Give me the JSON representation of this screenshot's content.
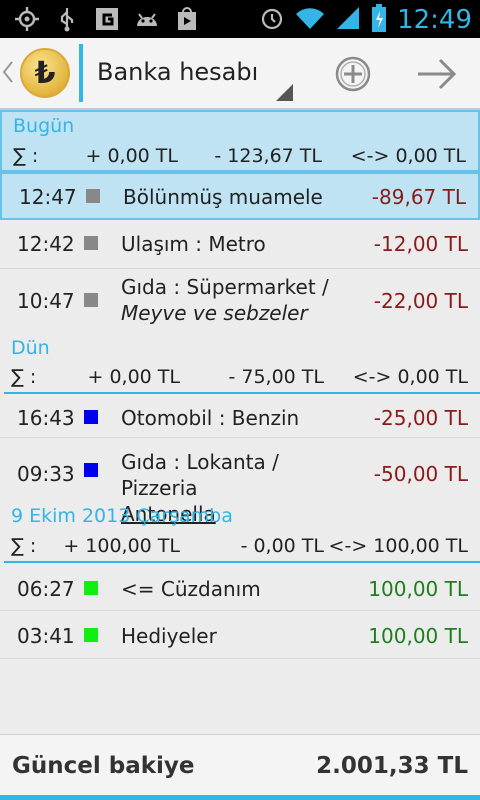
{
  "status_bar": {
    "time": "12:49"
  },
  "action_bar": {
    "currency_symbol": "₺",
    "account": "Banka hesabı"
  },
  "groups": [
    {
      "title": "Bugün",
      "sum_label": "∑ :",
      "income": "+ 0,00 TL",
      "expense": "- 123,67 TL",
      "balance": "<-> 0,00 TL",
      "rows": [
        {
          "time": "12:47",
          "color": "#888888",
          "name": "Bölünmüş muamele",
          "name2": "",
          "amount": "-89,67 TL"
        },
        {
          "time": "12:42",
          "color": "#888888",
          "name": "Ulaşım : Metro",
          "name2": "",
          "amount": "-12,00 TL"
        },
        {
          "time": "10:47",
          "color": "#888888",
          "name": "Gıda : Süpermarket /",
          "name2": "Meyve ve sebzeler",
          "amount": "-22,00 TL"
        }
      ]
    },
    {
      "title": "Dün",
      "sum_label": "∑ :",
      "income": "+ 0,00 TL",
      "expense": "- 75,00 TL",
      "balance": "<-> 0,00 TL",
      "rows": [
        {
          "time": "16:43",
          "color": "#0000ee",
          "name": "Otomobil : Benzin",
          "name2": "",
          "amount": "-25,00 TL"
        },
        {
          "time": "09:33",
          "color": "#0000ee",
          "name": "Gıda : Lokanta / Pizzeria",
          "name2": "Antonella",
          "amount": "-50,00 TL"
        }
      ]
    },
    {
      "title": "9 Ekim 2013 Çarşamba",
      "sum_label": "∑ :",
      "income": "+ 100,00 TL",
      "expense": "- 0,00 TL",
      "balance": "<-> 100,00 TL",
      "rows": [
        {
          "time": "06:27",
          "color": "#11ee11",
          "name": "<= Cüzdanım",
          "name2": "",
          "amount": "100,00 TL"
        },
        {
          "time": "03:41",
          "color": "#11ee11",
          "name": "Hediyeler",
          "name2": "",
          "amount": "100,00 TL"
        }
      ]
    }
  ],
  "footer": {
    "label": "Güncel bakiye",
    "value": "2.001,33 TL"
  }
}
